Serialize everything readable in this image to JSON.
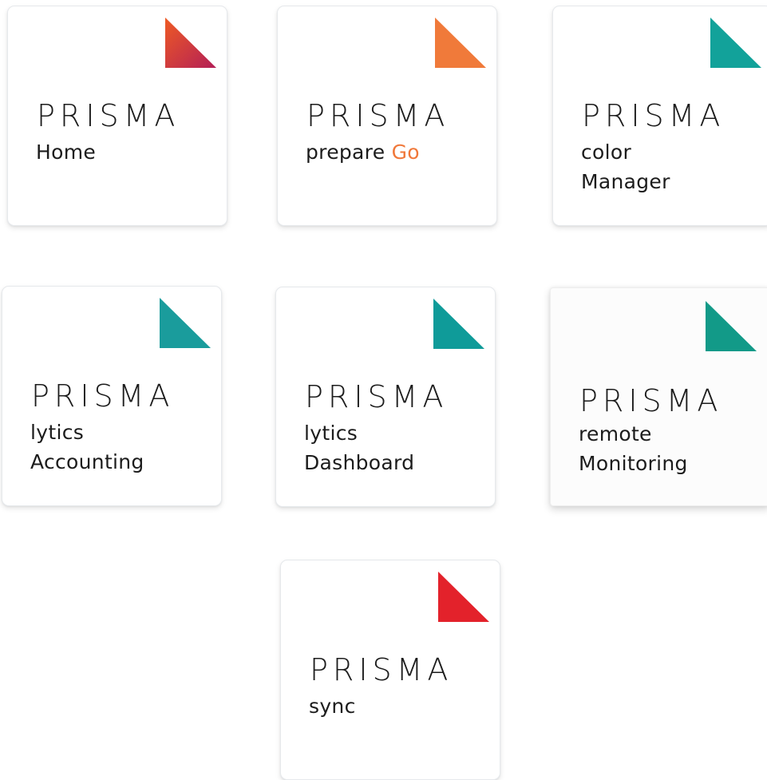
{
  "tiles": [
    {
      "id": "home",
      "brand": "PRISMA",
      "line1": "Home",
      "line2": "",
      "corner_color_start": "#ee5a24",
      "corner_color_end": "#b31f57"
    },
    {
      "id": "prepare-go",
      "brand": "PRISMA",
      "line1_prefix": "prepare ",
      "line1_accent": "Go",
      "accent_color": "#f0783a",
      "corner_color": "#f07a3a"
    },
    {
      "id": "color-manager",
      "brand": "PRISMA",
      "line1": "color",
      "line2": "Manager",
      "corner_color": "#12a29a"
    },
    {
      "id": "lytics-accounting",
      "brand": "PRISMA",
      "line1": "lytics",
      "line2": "Accounting",
      "corner_color": "#1a9c9c"
    },
    {
      "id": "lytics-dashboard",
      "brand": "PRISMA",
      "line1": "lytics",
      "line2": "Dashboard",
      "corner_color": "#0f9b99"
    },
    {
      "id": "remote-monitoring",
      "brand": "PRISMA",
      "line1": "remote",
      "line2": "Monitoring",
      "corner_color": "#129a88"
    },
    {
      "id": "sync",
      "brand": "PRISMA",
      "line1": "sync",
      "line2": "",
      "corner_color": "#e3222b"
    }
  ]
}
